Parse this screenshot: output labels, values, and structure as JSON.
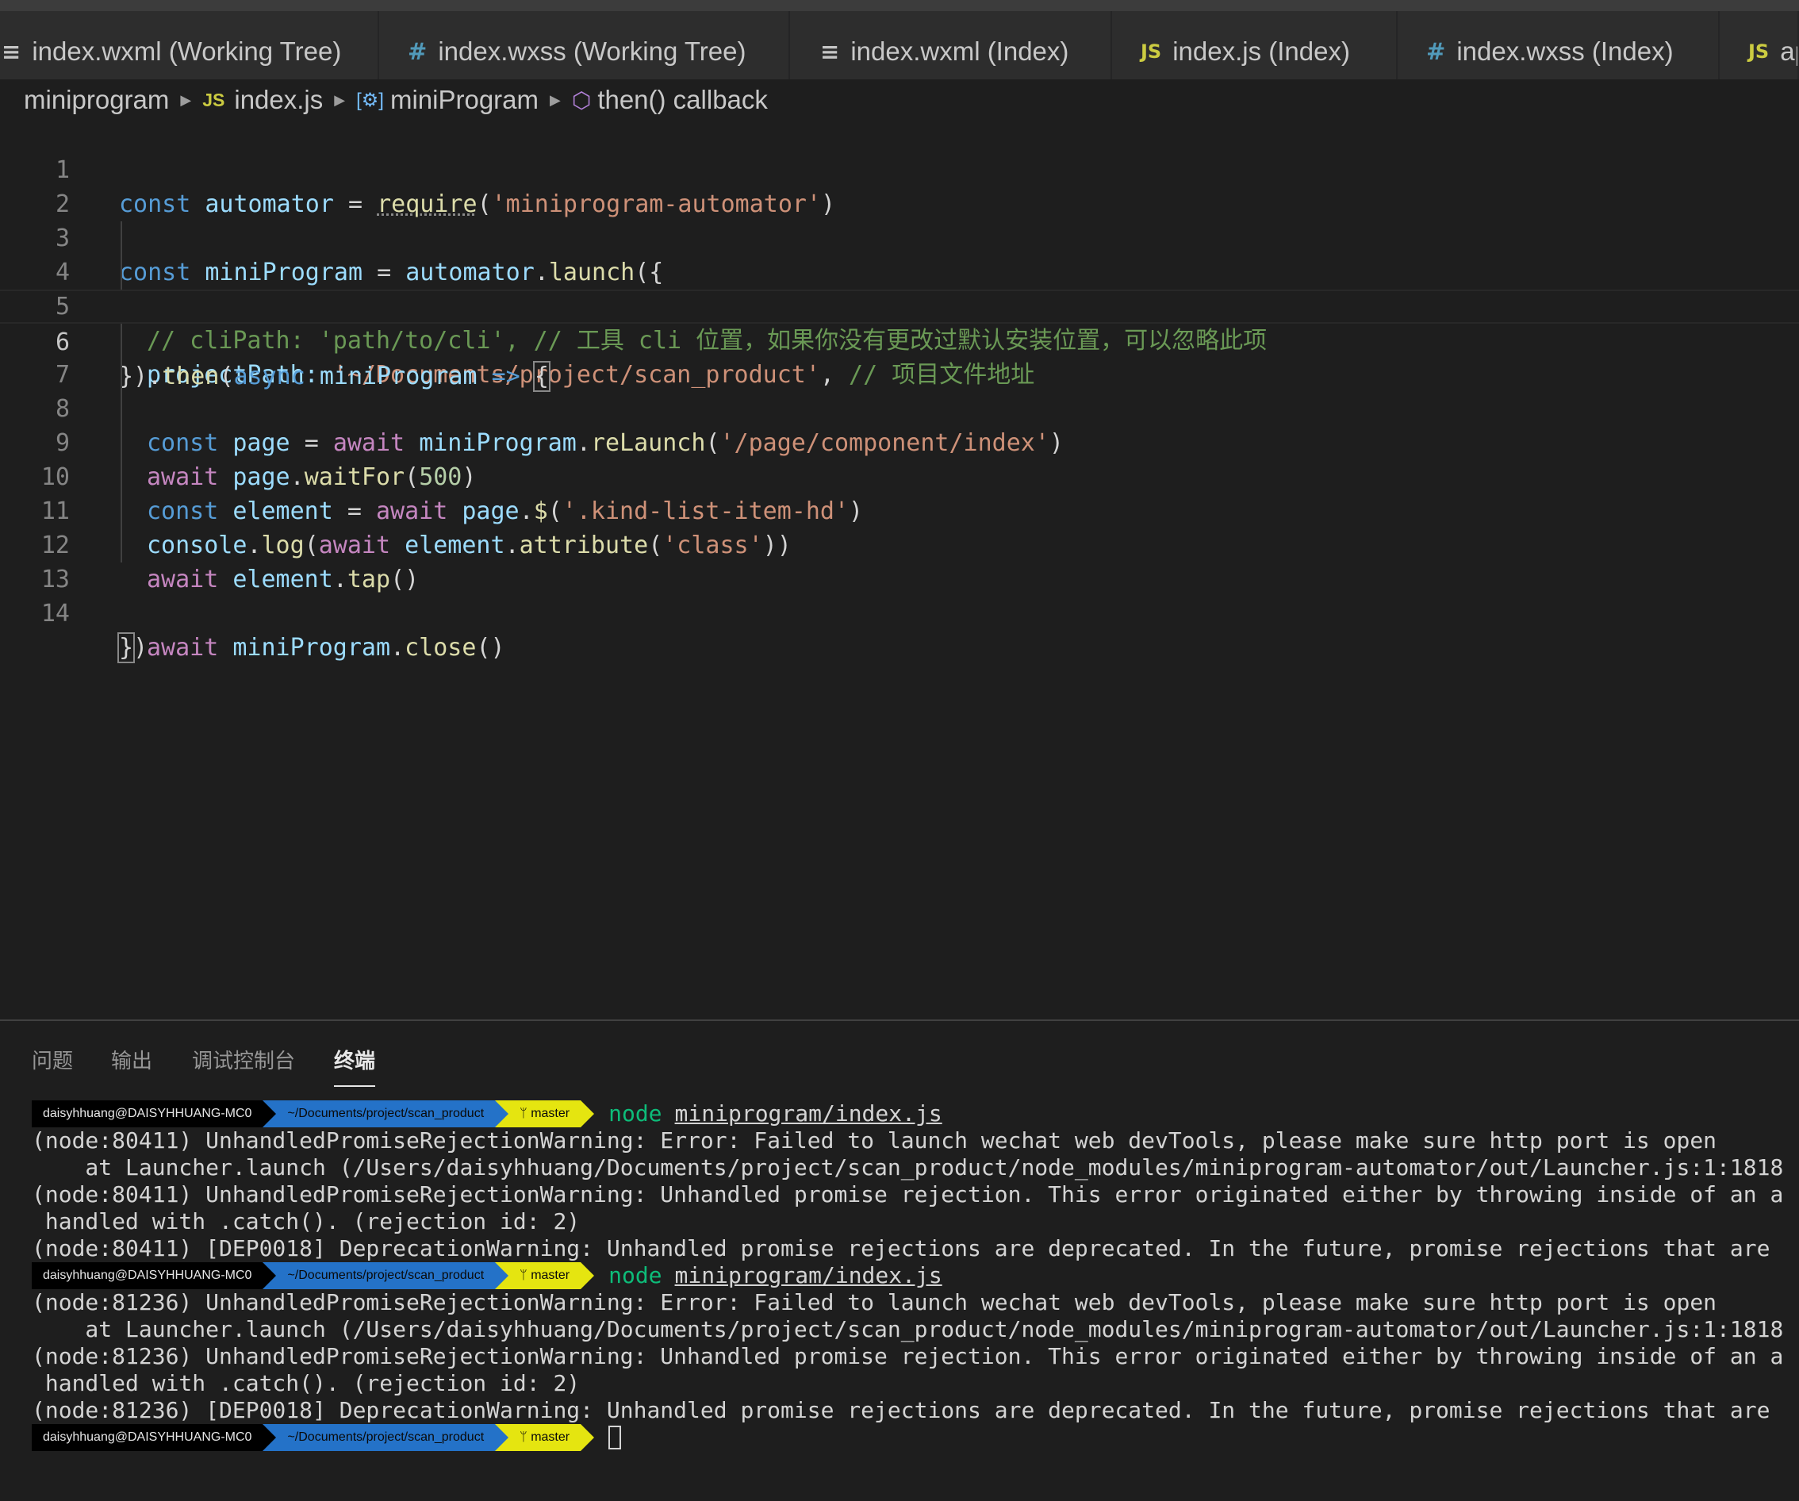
{
  "tabs": [
    {
      "icon": "≡",
      "label": "index.wxml (Working Tree)"
    },
    {
      "icon": "#",
      "label": "index.wxss (Working Tree)"
    },
    {
      "icon": "≡",
      "label": "index.wxml (Index)"
    },
    {
      "icon": "JS",
      "label": "index.js (Index)"
    },
    {
      "icon": "#",
      "label": "index.wxss (Index)"
    },
    {
      "icon": "JS",
      "label": "ap"
    }
  ],
  "breadcrumb": {
    "folder": "miniprogram",
    "file_icon": "JS",
    "file": "index.js",
    "symbol_icon": "[⚙]",
    "symbol": "miniProgram",
    "callback": "then() callback"
  },
  "editor": {
    "line_numbers": [
      "1",
      "2",
      "3",
      "4",
      "5",
      "6",
      "7",
      "8",
      "9",
      "10",
      "11",
      "12",
      "13",
      "14"
    ],
    "code": {
      "l1": {
        "t1": "const",
        "t2": "automator",
        "t3": "=",
        "t4": "require",
        "t5": "(",
        "t6": "'miniprogram-automator'",
        "t7": ")"
      },
      "l3": {
        "t1": "const",
        "t2": "miniProgram",
        "t3": "=",
        "t4": "automator",
        "t5": ".",
        "t6": "launch",
        "t7": "({"
      },
      "l4": {
        "t1": "// cliPath: 'path/to/cli', // 工具 cli 位置，如果你没有更改过默认安装位置，可以忽略此项"
      },
      "l5": {
        "t1": "projectPath:",
        "t2": "'~/Documents/project/scan_product'",
        "t3": ",",
        "t4": "// 项目文件地址"
      },
      "l6": {
        "t1": "}).",
        "t2": "then",
        "t3": "(",
        "t4": "async",
        "t5": "miniProgram",
        "t6": "=>",
        "t7": "{"
      },
      "l7": {
        "t1": "const",
        "t2": "page",
        "t3": "=",
        "t4": "await",
        "t5": "miniProgram",
        "t6": ".",
        "t7": "reLaunch",
        "t8": "(",
        "t9": "'/page/component/index'",
        "t10": ")"
      },
      "l8": {
        "t1": "await",
        "t2": "page",
        "t3": ".",
        "t4": "waitFor",
        "t5": "(",
        "t6": "500",
        "t7": ")"
      },
      "l9": {
        "t1": "const",
        "t2": "element",
        "t3": "=",
        "t4": "await",
        "t5": "page",
        "t6": ".",
        "t7": "$",
        "t8": "(",
        "t9": "'.kind-list-item-hd'",
        "t10": ")"
      },
      "l10": {
        "t1": "console",
        "t2": ".",
        "t3": "log",
        "t4": "(",
        "t5": "await",
        "t6": "element",
        "t7": ".",
        "t8": "attribute",
        "t9": "(",
        "t10": "'class'",
        "t11": "))"
      },
      "l11": {
        "t1": "await",
        "t2": "element",
        "t3": ".",
        "t4": "tap",
        "t5": "()"
      },
      "l13": {
        "t1": "await",
        "t2": "miniProgram",
        "t3": ".",
        "t4": "close",
        "t5": "()"
      },
      "l14": {
        "t1": "}",
        "t2": ")"
      }
    }
  },
  "panel": {
    "tabs": [
      "问题",
      "输出",
      "调试控制台",
      "终端"
    ],
    "active_tab": "终端"
  },
  "terminal": {
    "user": "daisyhhuang@DAISYHHUANG-MC0",
    "path": "~/Documents/project/scan_product",
    "branch": "master",
    "git_icon": "ᛘ",
    "cmd": "node",
    "cmd_arg": "miniprogram/index.js",
    "run1": [
      "(node:80411) UnhandledPromiseRejectionWarning: Error: Failed to launch wechat web devTools, please make sure http port is open",
      "    at Launcher.launch (/Users/daisyhhuang/Documents/project/scan_product/node_modules/miniprogram-automator/out/Launcher.js:1:1818",
      "(node:80411) UnhandledPromiseRejectionWarning: Unhandled promise rejection. This error originated either by throwing inside of an a",
      " handled with .catch(). (rejection id: 2)",
      "(node:80411) [DEP0018] DeprecationWarning: Unhandled promise rejections are deprecated. In the future, promise rejections that are"
    ],
    "run2": [
      "(node:81236) UnhandledPromiseRejectionWarning: Error: Failed to launch wechat web devTools, please make sure http port is open",
      "    at Launcher.launch (/Users/daisyhhuang/Documents/project/scan_product/node_modules/miniprogram-automator/out/Launcher.js:1:1818",
      "(node:81236) UnhandledPromiseRejectionWarning: Unhandled promise rejection. This error originated either by throwing inside of an a",
      " handled with .catch(). (rejection id: 2)",
      "(node:81236) [DEP0018] DeprecationWarning: Unhandled promise rejections are deprecated. In the future, promise rejections that are"
    ]
  }
}
